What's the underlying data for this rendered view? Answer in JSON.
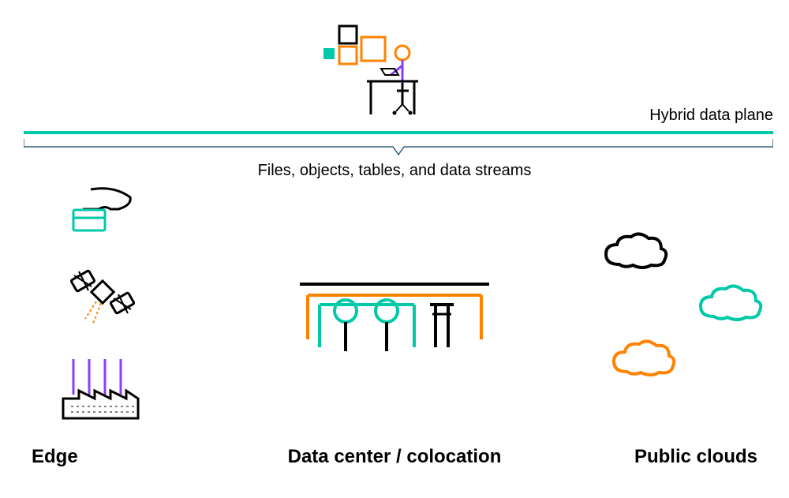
{
  "labels": {
    "hybrid": "Hybrid data plane",
    "files": "Files, objects, tables, and data streams",
    "edge": "Edge",
    "datacenter": "Data center / colocation",
    "publicclouds": "Public clouds"
  },
  "colors": {
    "teal": "#00c9a7",
    "orange": "#ff8300",
    "purple": "#8b3dff",
    "black": "#000000"
  }
}
